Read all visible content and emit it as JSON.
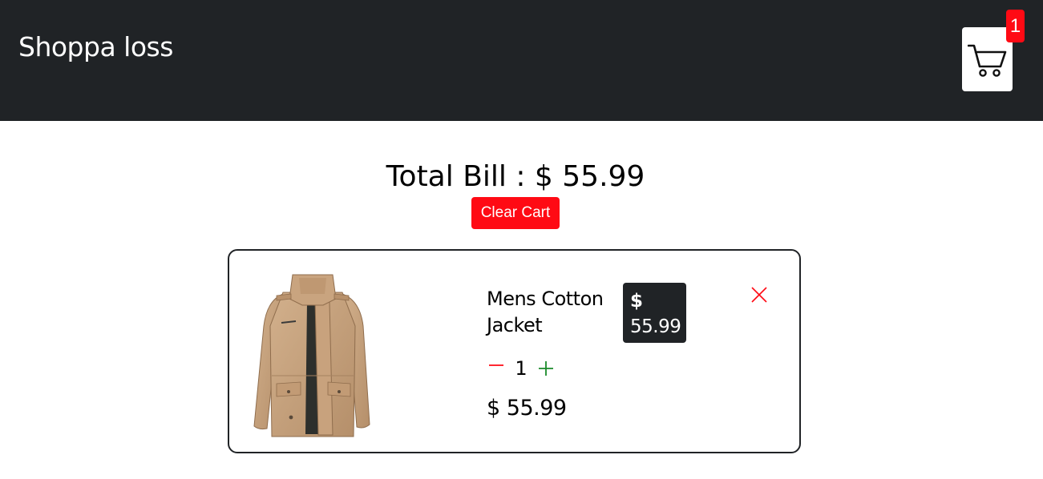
{
  "navbar": {
    "brand": "Shoppa loss",
    "cart_icon": "shopping-cart-icon",
    "cart_count": "1",
    "background": "#202326"
  },
  "cart": {
    "total_label": "Total Bill : $ 55.99",
    "clear_label": "Clear Cart",
    "items": [
      {
        "title": "Mens Cotton Jacket",
        "price_currency": "$",
        "price_value": "55.99",
        "quantity": "1",
        "subtotal": "$ 55.99",
        "image_icon": "jacket-image",
        "remove_icon": "close-icon",
        "decrement_icon": "minus-icon",
        "increment_icon": "plus-icon"
      }
    ]
  },
  "colors": {
    "accent_red": "#ff0a14",
    "dark": "#202326",
    "increment_green": "#1a8a2a"
  }
}
